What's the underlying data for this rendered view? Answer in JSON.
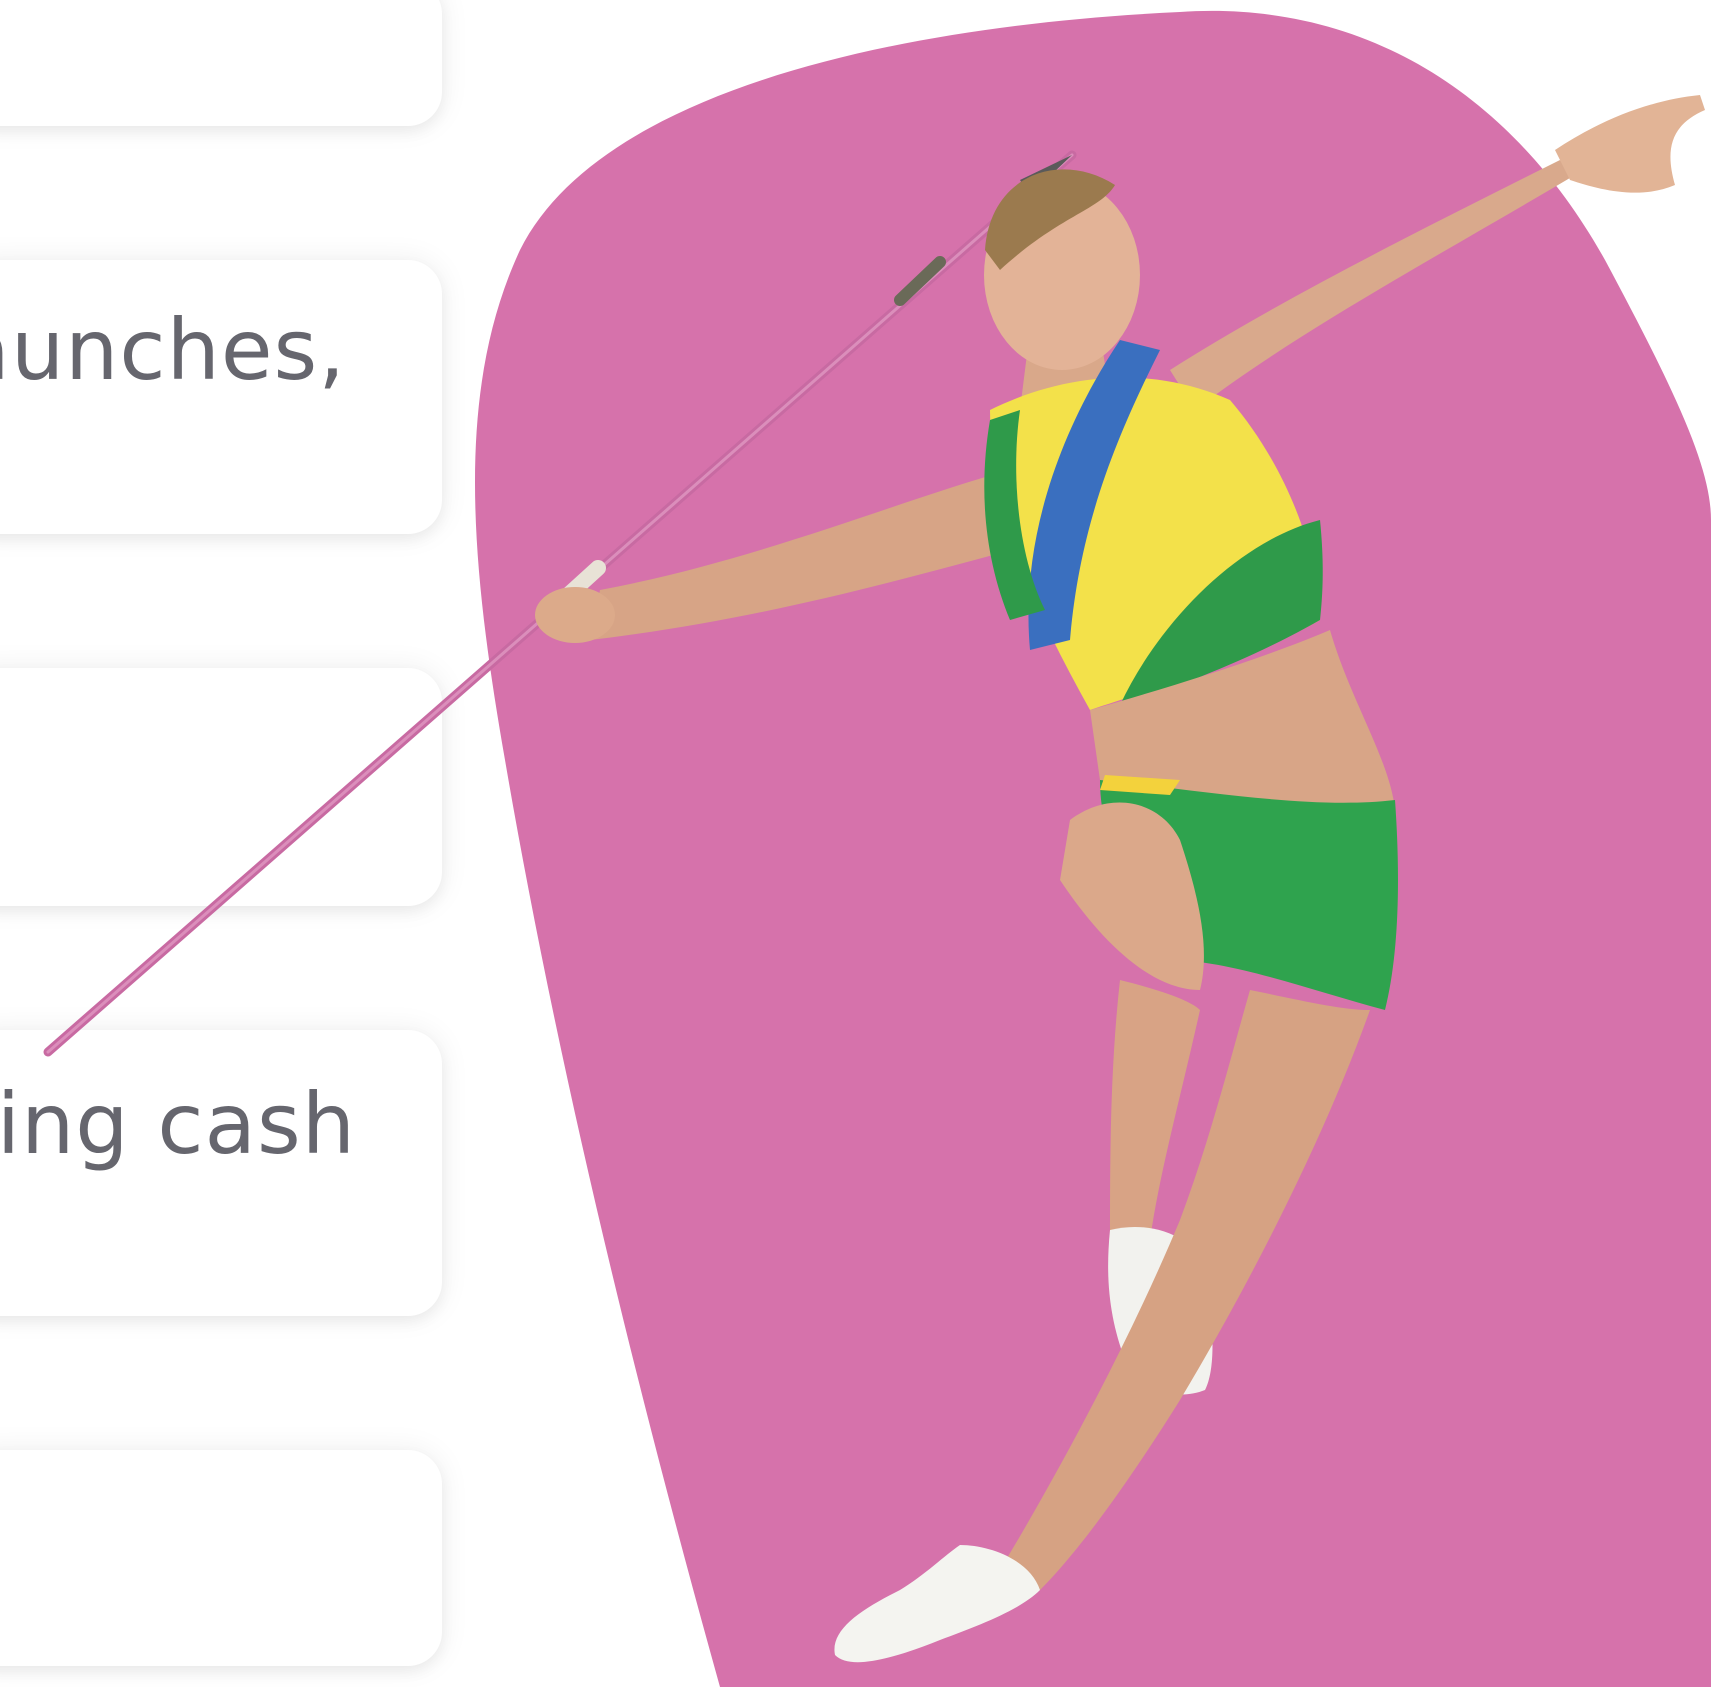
{
  "cards": [
    {
      "text": ""
    },
    {
      "text": "aunches,"
    },
    {
      "text": ""
    },
    {
      "text": "ting cash"
    },
    {
      "text": ""
    }
  ],
  "hero": {
    "blob_color": "#D672AB",
    "image": "javelin-thrower-athlete"
  }
}
